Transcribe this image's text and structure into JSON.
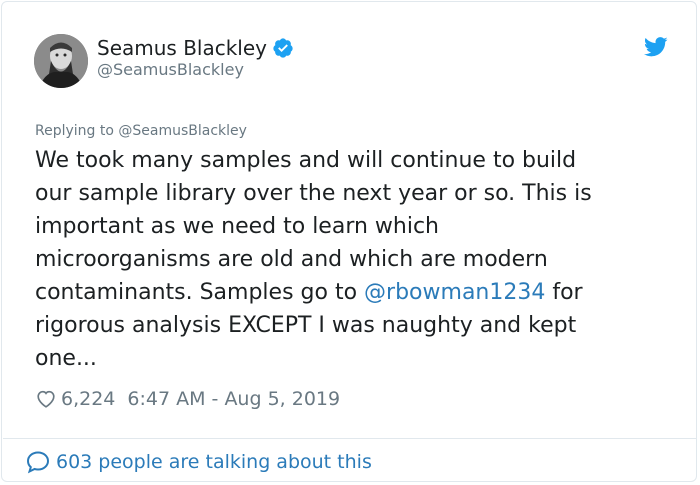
{
  "author": {
    "display_name": "Seamus Blackley",
    "handle": "@SeamusBlackley",
    "verified": true
  },
  "icons": {
    "verified": "verified-badge-icon",
    "platform": "twitter-bird-icon",
    "like": "heart-icon",
    "conversation": "speech-bubble-icon"
  },
  "reply": {
    "label": "Replying to @SeamusBlackley"
  },
  "tweet": {
    "lines": [
      "We took many samples and will continue to build",
      "our sample library over the next year or so. This is",
      "important as we need to learn which",
      "microorganisms are old and which are modern",
      "contaminants. Samples go to ",
      "rigorous analysis EXCEPT I was naughty and kept",
      "one..."
    ],
    "mention": "@rbowman1234",
    "mention_suffix": " for"
  },
  "stats": {
    "likes": "6,224",
    "timestamp": "6:47 AM - Aug 5, 2019"
  },
  "footer": {
    "talking": "603 people are talking about this"
  },
  "colors": {
    "link_blue": "#2b7bb9",
    "verified_blue": "#1da1f2",
    "secondary_text": "#697882",
    "primary_text": "#1c2022",
    "border": "#e1e8ed"
  }
}
